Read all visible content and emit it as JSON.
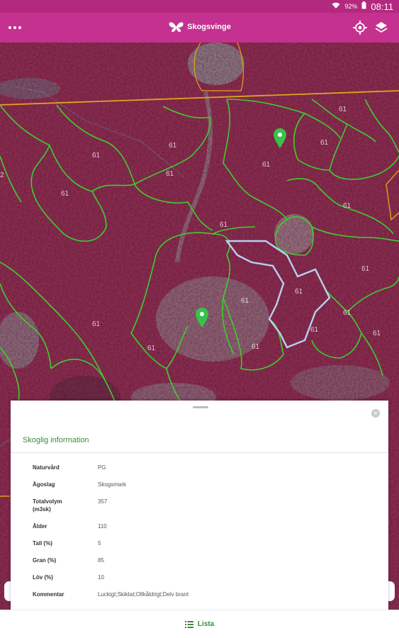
{
  "status_bar": {
    "battery": "92%",
    "time": "08:11"
  },
  "app_bar": {
    "brand_name": "Skogsvinge"
  },
  "map": {
    "stand_labels": [
      "61",
      "61",
      "61",
      "61",
      "61",
      "61",
      "61",
      "61",
      "61",
      "61",
      "61",
      "61",
      "61",
      "61",
      "61",
      "61",
      "61",
      "2"
    ]
  },
  "info_panel": {
    "title": "Skoglig information",
    "rows": [
      {
        "key": "Naturvård",
        "value": "PG"
      },
      {
        "key": "Ägoslag",
        "value": "Skogsmark"
      },
      {
        "key": "Totalvolym (m3sk)",
        "value": "357"
      },
      {
        "key": "Ålder",
        "value": "110"
      },
      {
        "key": "Tall (%)",
        "value": "5"
      },
      {
        "key": "Gran (%)",
        "value": "85"
      },
      {
        "key": "Löv (%)",
        "value": "10"
      },
      {
        "key": "Kommentar",
        "value": "Luckigt;Skiktat;Ollkåldrigt;Delv brant"
      }
    ]
  },
  "bottom_bar": {
    "list_label": "Lista"
  },
  "colors": {
    "brand": "#c4318f",
    "status_bar": "#b3297f",
    "stand_border": "#3ccf2d",
    "selected_border": "#b8d0f0",
    "property_line": "#e4a21d",
    "accent_green": "#3d8a3d",
    "pin": "#37c24a"
  }
}
